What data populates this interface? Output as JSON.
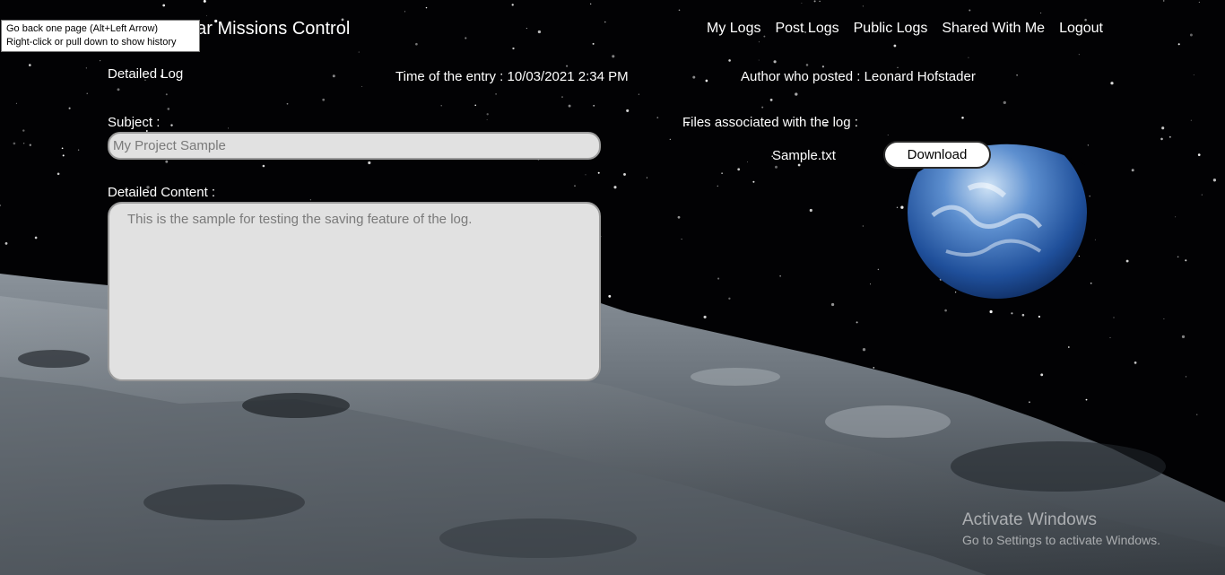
{
  "browser_tooltip": {
    "line1": "Go back one page (Alt+Left Arrow)",
    "line2": "Right-click or pull down to show history"
  },
  "navbar": {
    "brand": "nar Missions Control",
    "items": [
      {
        "label": "My Logs"
      },
      {
        "label": "Post Logs"
      },
      {
        "label": "Public Logs"
      },
      {
        "label": "Shared With Me"
      },
      {
        "label": "Logout"
      }
    ]
  },
  "log": {
    "heading": "Detailed Log",
    "time_label": "Time of the entry : 10/03/2021 2:34 PM",
    "author_label": "Author who posted : Leonard Hofstader",
    "subject_label": "Subject :",
    "subject_value": "My Project Sample",
    "content_label": "Detailed Content :",
    "content_value": "This is the sample for testing the saving feature of the log.",
    "files_label": "Files associated with the log :",
    "files": [
      {
        "name": "Sample.txt",
        "action_label": "Download"
      }
    ]
  },
  "watermark": {
    "title": "Activate Windows",
    "subtitle": "Go to Settings to activate Windows."
  }
}
